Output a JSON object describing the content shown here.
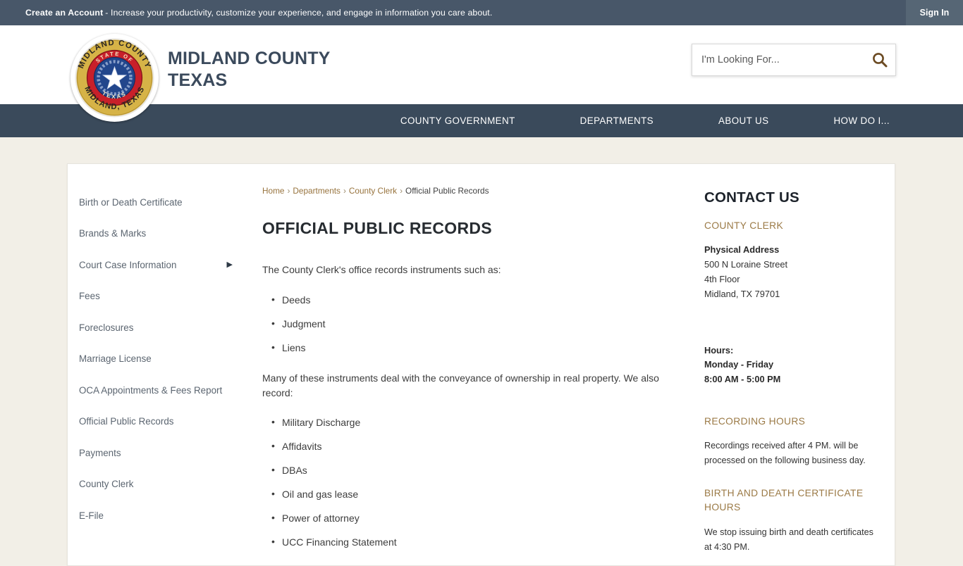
{
  "topbar": {
    "account_link": "Create an Account",
    "message": "- Increase your productivity, customize your experience, and engage in information you care about.",
    "signin_label": "Sign In"
  },
  "header": {
    "site_title_line1": "MIDLAND COUNTY",
    "site_title_line2": "TEXAS",
    "seal": {
      "outer_top_text": "MIDLAND  COUNTY",
      "outer_bottom_text": "MIDLAND, TEXAS",
      "inner_top_text": "STATE OF",
      "inner_bottom_text": "TEXAS",
      "gold_ring": "#d6b347",
      "red_ring": "#c8202a",
      "blue_center": "#22468c"
    },
    "search": {
      "placeholder": "I'm Looking For...",
      "value": "",
      "icon": "search-icon",
      "icon_color": "#6b4a22"
    }
  },
  "nav": {
    "items": [
      {
        "label": "COUNTY GOVERNMENT"
      },
      {
        "label": "DEPARTMENTS"
      },
      {
        "label": "ABOUT US"
      },
      {
        "label": "HOW DO I..."
      }
    ],
    "background": "#3a4a5b"
  },
  "sidebar": {
    "items": [
      {
        "label": "Birth or Death Certificate",
        "has_submenu": false
      },
      {
        "label": "Brands & Marks",
        "has_submenu": false
      },
      {
        "label": "Court Case Information",
        "has_submenu": true,
        "arrow": "▶"
      },
      {
        "label": "Fees",
        "has_submenu": false
      },
      {
        "label": "Foreclosures",
        "has_submenu": false
      },
      {
        "label": "Marriage License",
        "has_submenu": false
      },
      {
        "label": "OCA Appointments & Fees Report",
        "has_submenu": false
      },
      {
        "label": "Official Public Records",
        "has_submenu": false
      },
      {
        "label": "Payments",
        "has_submenu": false
      },
      {
        "label": "County Clerk",
        "has_submenu": false
      },
      {
        "label": "E-File",
        "has_submenu": false
      }
    ]
  },
  "breadcrumb": {
    "items": [
      {
        "label": "Home",
        "link": true
      },
      {
        "label": "Departments",
        "link": true
      },
      {
        "label": "County Clerk",
        "link": true
      },
      {
        "label": "Official Public Records",
        "link": false
      }
    ],
    "separator": "›"
  },
  "main": {
    "title": "OFFICIAL PUBLIC RECORDS",
    "paragraph1": "The County Clerk's office records instruments such as:",
    "list1": [
      "Deeds",
      "Judgment",
      "Liens"
    ],
    "paragraph2": "Many of these instruments deal with the conveyance of ownership in real property. We also record:",
    "list2": [
      "Military Discharge",
      "Affidavits",
      "DBAs",
      "Oil and gas lease",
      "Power of attorney",
      "UCC Financing Statement"
    ]
  },
  "contact": {
    "heading": "CONTACT US",
    "department": "COUNTY CLERK",
    "address_label": "Physical Address",
    "address_lines": [
      "500 N Loraine Street",
      "4th Floor",
      "Midland, TX 79701"
    ],
    "hours_label": "Hours:",
    "hours_days": "Monday - Friday",
    "hours_times": "8:00 AM - 5:00 PM",
    "recording_heading": "RECORDING HOURS",
    "recording_text": "Recordings received after 4 PM. will be processed on the following business day.",
    "birth_heading": "BIRTH AND DEATH CERTIFICATE HOURS",
    "birth_text": "We stop issuing birth and death certificates at 4:30 PM.",
    "accent_color": "#9b7a46"
  }
}
